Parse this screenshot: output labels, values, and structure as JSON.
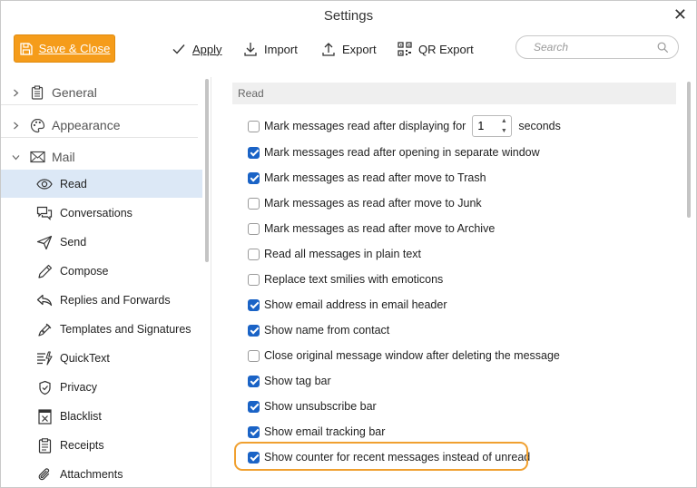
{
  "window": {
    "title": "Settings"
  },
  "toolbar": {
    "save_close": "Save & Close",
    "apply": "Apply",
    "import": "Import",
    "export": "Export",
    "qr_export": "QR Export",
    "search_placeholder": "Search"
  },
  "sidebar": {
    "groups": [
      {
        "label": "General",
        "icon": "clipboard-icon"
      },
      {
        "label": "Appearance",
        "icon": "palette-icon"
      },
      {
        "label": "Mail",
        "icon": "envelope-icon"
      }
    ],
    "items": [
      {
        "label": "Read",
        "icon": "eye-icon",
        "active": true
      },
      {
        "label": "Conversations",
        "icon": "chat-icon"
      },
      {
        "label": "Send",
        "icon": "send-icon"
      },
      {
        "label": "Compose",
        "icon": "pen-icon"
      },
      {
        "label": "Replies and Forwards",
        "icon": "reply-icon"
      },
      {
        "label": "Templates and Signatures",
        "icon": "signature-icon"
      },
      {
        "label": "QuickText",
        "icon": "quicktext-icon"
      },
      {
        "label": "Privacy",
        "icon": "shield-icon"
      },
      {
        "label": "Blacklist",
        "icon": "blacklist-icon"
      },
      {
        "label": "Receipts",
        "icon": "receipt-icon"
      },
      {
        "label": "Attachments",
        "icon": "paperclip-icon"
      }
    ]
  },
  "main": {
    "section_title": "Read",
    "options": [
      {
        "pre": "Mark messages read after displaying for",
        "value": "1",
        "post": "seconds",
        "checked": false
      },
      {
        "label": "Mark messages read after opening in separate window",
        "checked": true
      },
      {
        "label": "Mark messages as read after move to Trash",
        "checked": true
      },
      {
        "label": "Mark messages as read after move to Junk",
        "checked": false
      },
      {
        "label": "Mark messages as read after move to Archive",
        "checked": false
      },
      {
        "label": "Read all messages in plain text",
        "checked": false
      },
      {
        "label": "Replace text smilies with emoticons",
        "checked": false
      },
      {
        "label": "Show email address in email header",
        "checked": true
      },
      {
        "label": "Show name from contact",
        "checked": true
      },
      {
        "label": "Close original message window after deleting the message",
        "checked": false
      },
      {
        "label": "Show tag bar",
        "checked": true
      },
      {
        "label": "Show unsubscribe bar",
        "checked": true
      },
      {
        "label": "Show email tracking bar",
        "checked": true
      },
      {
        "label": "Show counter for recent messages instead of unread",
        "checked": true,
        "highlighted": true
      }
    ]
  },
  "colors": {
    "accent": "#f59c1a",
    "checkbox": "#1a63c6",
    "selection": "#dce8f6"
  }
}
